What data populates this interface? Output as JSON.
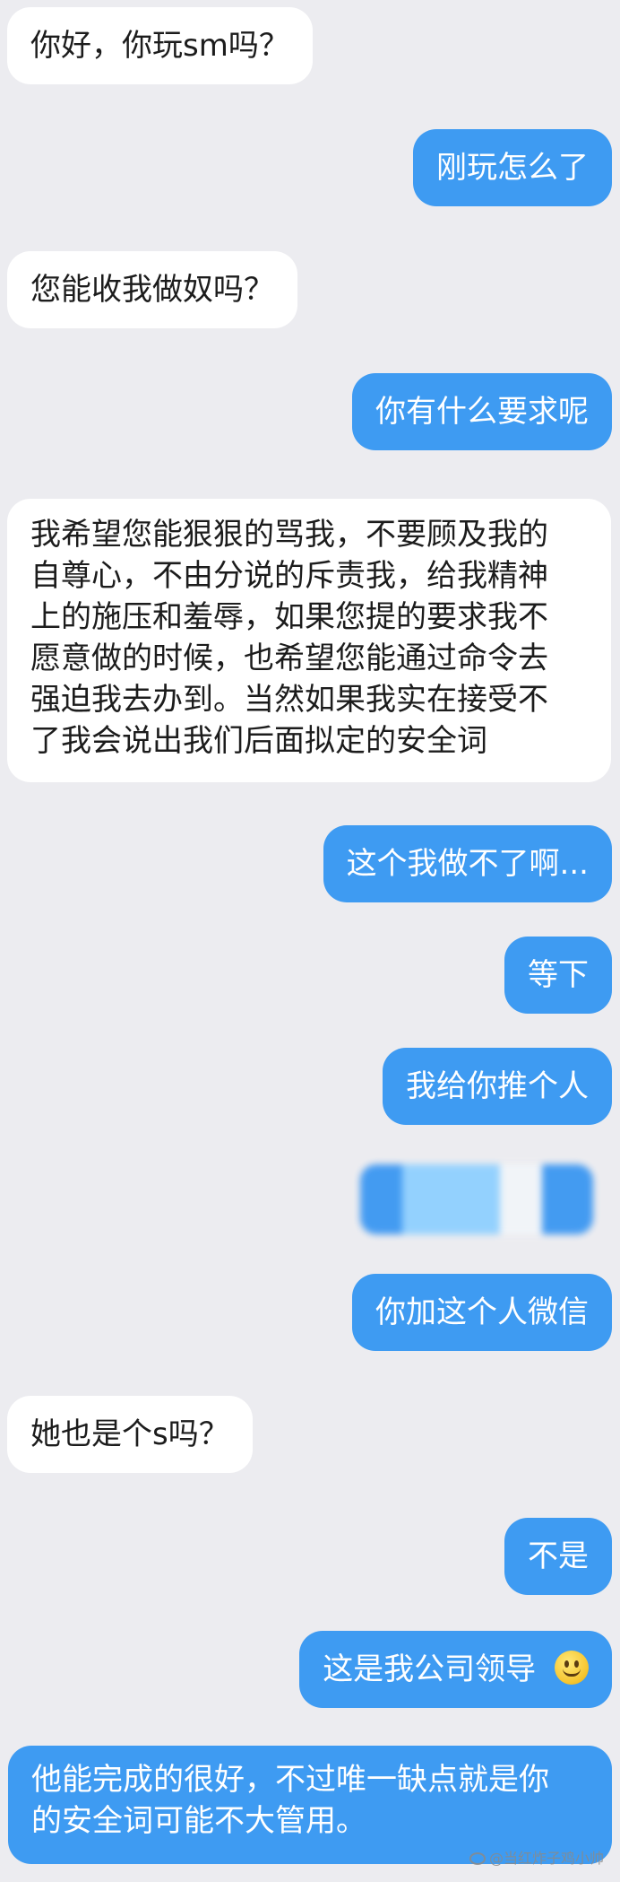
{
  "messages": [
    {
      "side": "in",
      "text": "你好，你玩sm吗？"
    },
    {
      "side": "out",
      "text": "刚玩怎么了"
    },
    {
      "side": "in",
      "text": "您能收我做奴吗？"
    },
    {
      "side": "out",
      "text": "你有什么要求呢"
    },
    {
      "side": "in",
      "lines": [
        "我希望您能狠狠的骂我，不要顾及我的",
        "自尊心，不由分说的斥责我，给我精神",
        "上的施压和羞辱，如果您提的要求我不",
        "愿意做的时候，也希望您能通过命令去",
        "强迫我去办到。当然如果我实在接受不",
        "了我会说出我们后面拟定的安全词"
      ]
    },
    {
      "side": "out",
      "text": "这个我做不了啊..."
    },
    {
      "side": "out",
      "text": "等下"
    },
    {
      "side": "out",
      "text": "我给你推个人"
    },
    {
      "side": "out",
      "text": "你加这个人微信"
    },
    {
      "side": "in",
      "text": "她也是个s吗？"
    },
    {
      "side": "out",
      "text": "不是"
    },
    {
      "side": "out",
      "text": "这是我公司领导",
      "emoji": "smile-emoji"
    },
    {
      "side": "out",
      "lines": [
        "他能完成的很好，不过唯一缺点就是你",
        "的安全词可能不大管用。"
      ]
    }
  ],
  "watermark": "@当红炸子鸡小帅",
  "colors": {
    "background": "#ececf0",
    "incoming_bubble": "#ffffff",
    "outgoing_bubble": "#3e9bf2",
    "outgoing_text": "#ffffff",
    "incoming_text": "#1c1c1c"
  }
}
